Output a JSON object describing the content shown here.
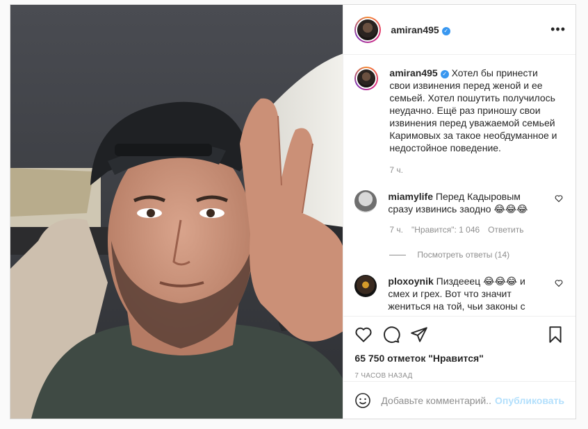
{
  "post": {
    "author": "amiran495",
    "verified_icon": "verified-badge-icon",
    "more_icon": "more-options-icon",
    "caption": "Хотел бы принести свои извинения перед женой и ее семьей. Хотел пошутить получилось неудачно. Ещё раз приношу свои извинения перед уважаемой семьей Каримовых за такое необдуманное и недостойное поведение.",
    "caption_time": "7 ч.",
    "likes": "65 750 отметок \"Нравится\"",
    "posted": "7 часов назад"
  },
  "comments": [
    {
      "user": "miamylife",
      "text": "Перед Кадыровым сразу извинись заодно 😂😂😂",
      "time": "7 ч.",
      "likes": "\"Нравится\": 1 046",
      "reply": "Ответить",
      "view_replies": "Посмотреть ответы (14)"
    },
    {
      "user": "ploxoynik",
      "text": "Пиздееец 😂😂😂 и смех и грех. Вот что значит жениться на той, чьи законы с"
    }
  ],
  "composer": {
    "placeholder": "Добавьте комментарий...",
    "publish": "Опубликовать"
  },
  "colors": {
    "accent": "#3897f0",
    "publish_disabled": "#b2dffc",
    "muted": "#8e8e8e"
  }
}
